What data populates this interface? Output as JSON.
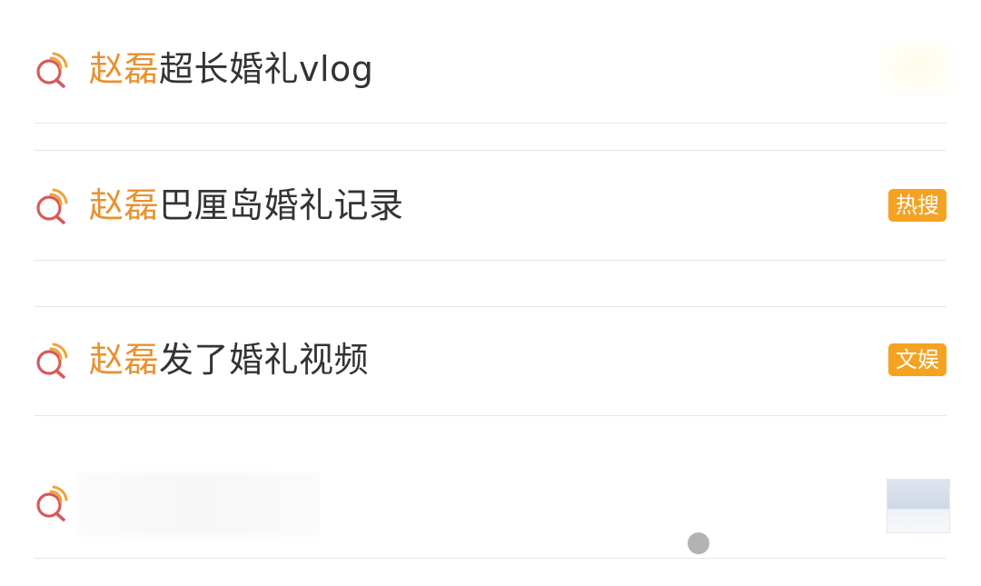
{
  "suggestions": [
    {
      "highlight": "赵磊",
      "rest": "超长婚礼vlog",
      "tag": ""
    },
    {
      "highlight": "赵磊",
      "rest": "巴厘岛婚礼记录",
      "tag": "热搜"
    },
    {
      "highlight": "赵磊",
      "rest": "发了婚礼视频",
      "tag": "文娱"
    },
    {
      "highlight": "",
      "rest": "",
      "tag": ""
    }
  ],
  "colors": {
    "highlight": "#e8912f",
    "text": "#333333",
    "tag_bg": "#f5a223",
    "icon_red": "#d65a5a",
    "icon_orange": "#f0a23a"
  }
}
